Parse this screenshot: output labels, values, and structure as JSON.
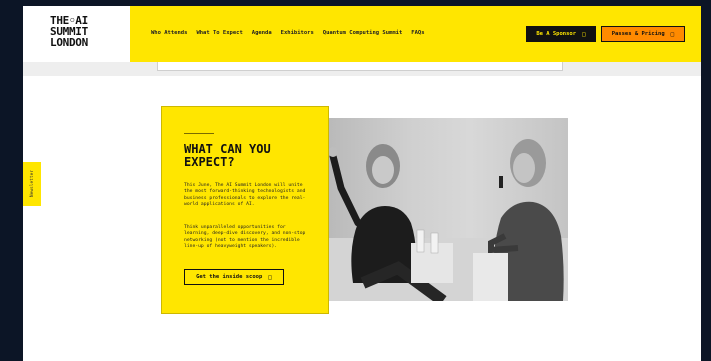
{
  "logo": {
    "line1": "THE◦AI",
    "line2": "SUMMIT",
    "line3": "LONDON"
  },
  "nav": {
    "links": [
      "Who Attends",
      "What To Expect",
      "Agenda",
      "Exhibitors",
      "Quantum Computing Summit",
      "FAQs"
    ],
    "sponsor_label": "Be A Sponsor",
    "passes_label": "Passes & Pricing"
  },
  "side_tab": {
    "label": "Newsletter"
  },
  "expect": {
    "heading": "WHAT CAN YOU EXPECT?",
    "paragraph1": "This June, The AI Summit London will unite the most forward-thinking technologists and business professionals to explore the real-world applications of AI.",
    "paragraph2": "Think unparalleled opportunities for learning, deep-dive discovery, and non-stop networking (not to mention the incredible line-up of heavyweight speakers).",
    "cta_label": "Get the inside scoop"
  },
  "colors": {
    "brand_yellow": "#ffe600",
    "passes_orange": "#ff8a00",
    "background": "#0c1526"
  },
  "icons": {
    "button_arrow": "→",
    "box_glyph": "□"
  }
}
